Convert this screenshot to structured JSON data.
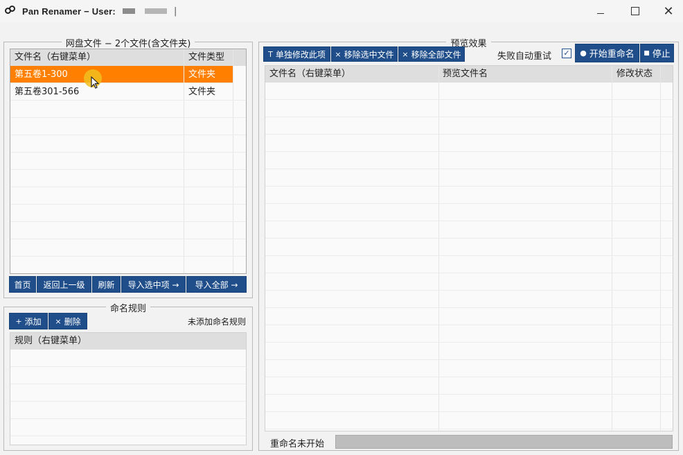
{
  "window": {
    "title": "Pan Renamer − User:",
    "caret": "|",
    "minimize_glyph": "",
    "close_glyph": "✕"
  },
  "cloud_files": {
    "legend": "网盘文件 − 2个文件(含文件夹)",
    "columns": [
      "文件名（右键菜单）",
      "文件类型"
    ],
    "rows": [
      {
        "name": "第五卷1-300",
        "type": "文件夹",
        "selected": true
      },
      {
        "name": "第五卷301-566",
        "type": "文件夹",
        "selected": false
      }
    ],
    "buttons": [
      "首页",
      "返回上一级",
      "刷新",
      "导入选中项 →",
      "导入全部 →"
    ]
  },
  "naming_rules": {
    "legend": "命名规则",
    "add_label": "添加",
    "add_icon": "+",
    "delete_label": "删除",
    "delete_icon": "×",
    "status": "未添加命名规则",
    "columns": [
      "规则（右键菜单）"
    ]
  },
  "preview": {
    "legend": "预览效果",
    "edit_single_label": "单独修改此项",
    "edit_single_icon": "T",
    "remove_selected_label": "移除选中文件",
    "remove_all_label": "移除全部文件",
    "remove_icon": "×",
    "auto_retry_label": "失败自动重试",
    "auto_retry_checked": true,
    "check_glyph": "✓",
    "start_label": "开始重命名",
    "start_icon": "●",
    "stop_label": "停止",
    "stop_icon": "■",
    "columns": [
      "文件名（右键菜单）",
      "预览文件名",
      "修改状态"
    ],
    "status_text": "重命名未开始",
    "progress": 0
  },
  "colors": {
    "accent": "#1f4e8a",
    "selection": "#ff8000"
  }
}
